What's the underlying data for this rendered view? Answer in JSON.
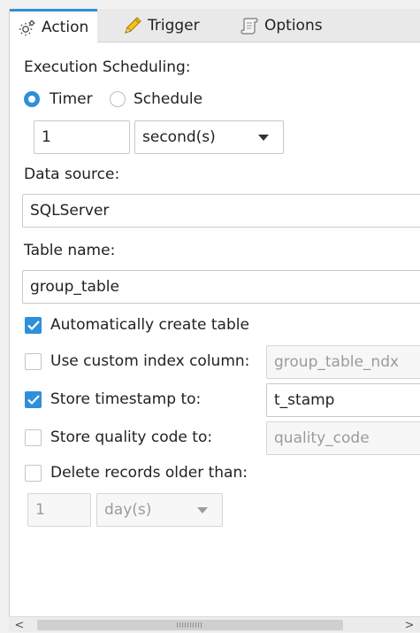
{
  "tabs": [
    {
      "label": "Action",
      "icon": "gear-icon",
      "active": true
    },
    {
      "label": "Trigger",
      "icon": "pencil-icon",
      "active": false
    },
    {
      "label": "Options",
      "icon": "scroll-icon",
      "active": false
    }
  ],
  "scheduling": {
    "label": "Execution Scheduling:",
    "timer_label": "Timer",
    "schedule_label": "Schedule",
    "selected": "Timer",
    "interval_value": "1",
    "interval_unit": "second(s)"
  },
  "data_source": {
    "label": "Data source:",
    "value": "SQLServer"
  },
  "table": {
    "label": "Table name:",
    "value": "group_table"
  },
  "options": {
    "auto_create": {
      "label": "Automatically create table",
      "checked": true
    },
    "custom_index": {
      "label": "Use custom index column:",
      "checked": false,
      "value": "group_table_ndx"
    },
    "timestamp": {
      "label": "Store timestamp to:",
      "checked": true,
      "value": "t_stamp"
    },
    "quality": {
      "label": "Store quality code to:",
      "checked": false,
      "value": "quality_code"
    },
    "delete_older": {
      "label": "Delete records older than:",
      "checked": false,
      "value": "1",
      "unit": "day(s)"
    }
  },
  "scrollbar": {
    "left_arrow": "<",
    "right_arrow": ">"
  },
  "colors": {
    "accent": "#2f8fd8"
  }
}
